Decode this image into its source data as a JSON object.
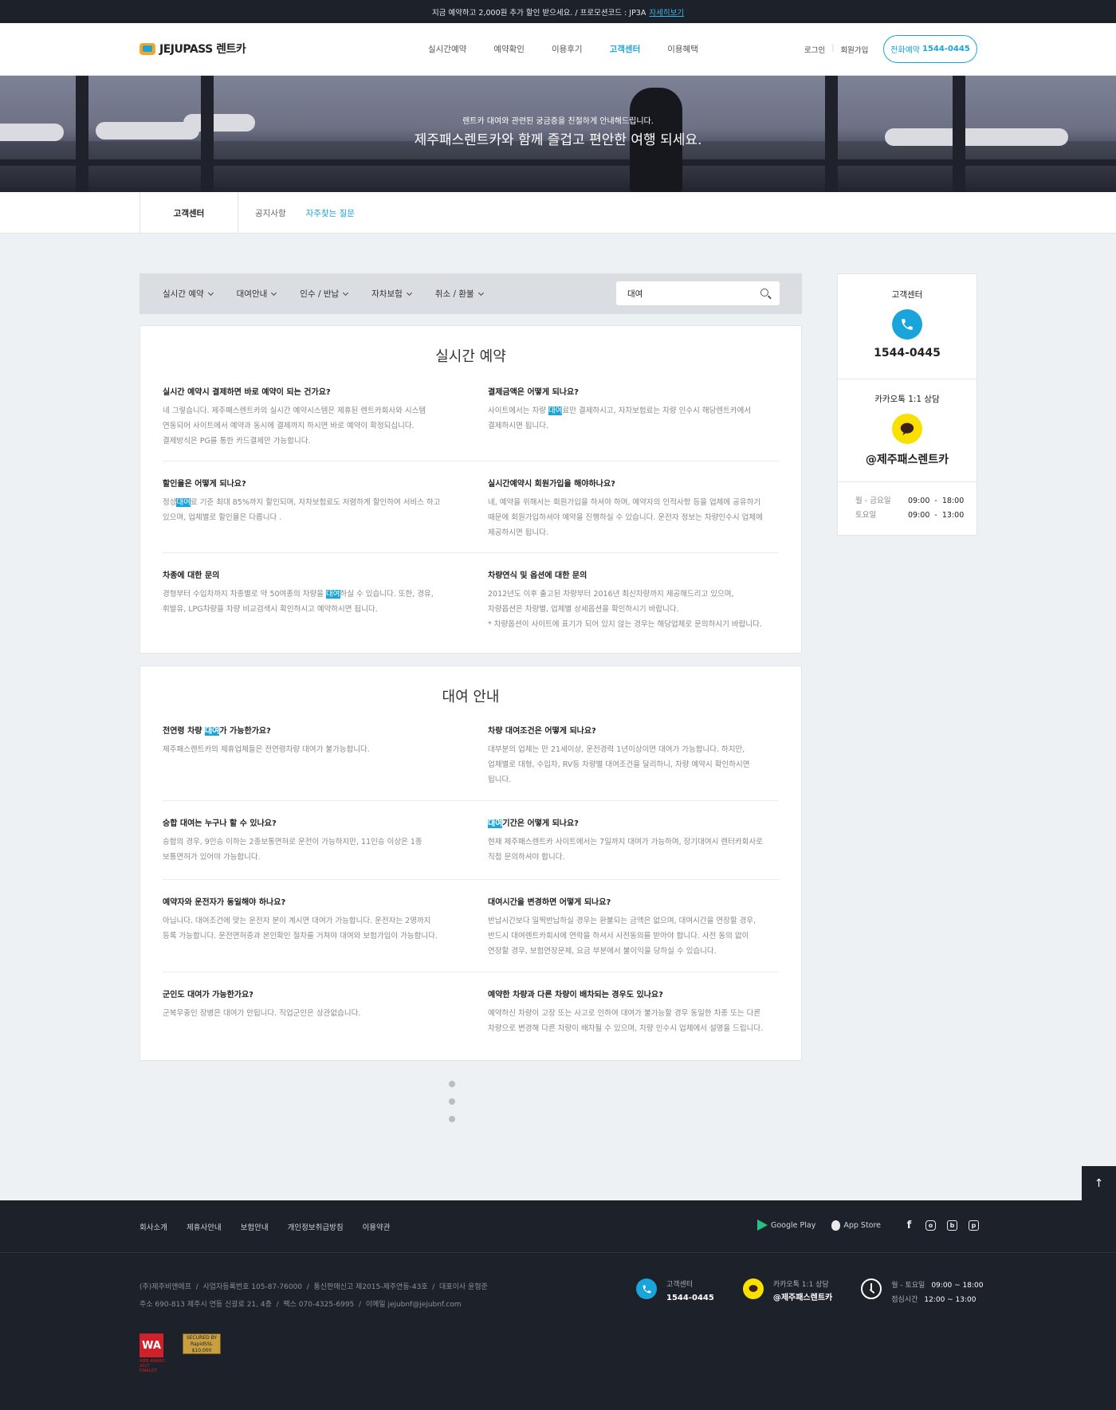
{
  "promo": {
    "text": "지금 예약하고 2,000원 추가 할인 받으세요. / 프로모션코드 : JP3A",
    "link": "자세히보기"
  },
  "header": {
    "logo": "JEJUPASS 렌트카",
    "nav": [
      "실시간예약",
      "예약확인",
      "이용후기",
      "고객센터",
      "이용혜택"
    ],
    "nav_active": "고객센터",
    "login": "로그인",
    "signup": "회원가입",
    "call_label": "전화예약",
    "call_number": "1544-0445"
  },
  "hero": {
    "subtitle": "렌트카 대여와 관련된 궁금증을 친절하게 안내해드립니다.",
    "title": "제주패스렌트카와 함께 즐겁고 편안한 여행 되세요."
  },
  "subnav": {
    "title": "고객센터",
    "items": [
      "공지사항",
      "자주찾는 질문"
    ],
    "active": "자주찾는 질문"
  },
  "filter": {
    "categories": [
      "실시간 예약",
      "대여안내",
      "인수 / 반납",
      "자차보험",
      "취소 / 환불"
    ],
    "search_value": "대여",
    "search_icon": "search-icon"
  },
  "sections": [
    {
      "title": "실시간 예약",
      "items": [
        {
          "q": "실시간 예약시 결제하면 바로 예약이 되는 건가요?",
          "a": [
            "네 그렇습니다. 제주패스렌트카의 실시간 예약시스템은 제휴된 렌트카회사와 시스템",
            "연동되어 사이트에서 예약과 동시에 결제까지 하시면 바로 예약이 확정되십니다.",
            "결제방식은 PG를 통한 카드결제만 가능합니다."
          ]
        },
        {
          "q": "결제금액은 어떻게 되나요?",
          "a": [
            "사이트에서는 차량 [대여]료만 결제하시고, 자차보험료는 차량 인수시 해당렌트카에서",
            "결제하시면 됩니다."
          ]
        },
        {
          "q": "할인율은 어떻게 되나요?",
          "a": [
            "정상[대여]료 기준 최대 85%까지 할인되며, 자차보험료도 저렴하게 할인하여 서비스 하고",
            "있으며, 업체별로 할인율은 다릅니다 ."
          ]
        },
        {
          "q": "실시간예약시 회원가입을 해야하나요?",
          "a": [
            "네, 예약을 위해서는 회원가입을 하셔야 하며, 예약자의 인적사항 등을 업체에 공유하기",
            "때문에 회원가입하셔야 예약을 진행하실 수 있습니다. 운전자 정보는 차량인수시 업체에",
            "제공하시면 됩니다."
          ]
        },
        {
          "q": "차종에 대한 문의",
          "a": [
            "경형부터 수입차까지 차종별로 약 50여종의 차량을 [대여]하실 수 있습니다. 또한, 경유,",
            "휘발유, LPG차량을 차량 비교검색시 확인하시고 예약하시면 됩니다."
          ]
        },
        {
          "q": "차량연식 및 옵션에 대한 문의",
          "a": [
            "2012년도 이후 출고된 차량부터 2016년 최신차량까지 제공해드리고 있으며,",
            "차량옵션은 차량별, 업체별 상세옵션을 확인하시기 바랍니다.",
            "* 차량옵션이 사이트에 표기가 되어 있지 않는 경우는 해당업체로 문의하시기 바랍니다."
          ]
        }
      ]
    },
    {
      "title": "대여 안내",
      "items": [
        {
          "q": "전연령 차량 [대여]가 가능한가요?",
          "a": [
            "제주패스렌트카의 제휴업체들은 전연령차량 대여가 불가능합니다."
          ]
        },
        {
          "q": "차량 대여조건은 어떻게 되나요?",
          "a": [
            "대부분의 업체는 만 21세이상, 운전경력 1년이상이면 대여가 가능합니다. 하지만,",
            "업체별로 대형, 수입차, RV등 차량별 대여조건을 달리하니, 차량 예약시 확인하시면",
            "됩니다."
          ]
        },
        {
          "q": "승합 대여는 누구나 할 수 있나요?",
          "a": [
            "승합의 경우, 9인승 이하는 2종보통면허로 운전이 가능하지만, 11인승 이상은 1종",
            "보통면허가 있어야 가능합니다."
          ]
        },
        {
          "q": "[대여]기간은 어떻게 되나요?",
          "a": [
            "현재 제주패스렌트카 사이트에서는 7일까지 대여가 가능하며, 장기대여시 렌터카회사로",
            "직접 문의하셔야 합니다."
          ]
        },
        {
          "q": "예약자와 운전자가 동일해야 하나요?",
          "a": [
            "아닙니다. 대여조건에 맞는 운전자 분이 계시면 대여가 가능합니다. 운전자는 2명까지",
            "등록 가능합니다. 운전면허증과 본인확인 절차를 거쳐야 대여와 보험가입이 가능합니다."
          ]
        },
        {
          "q": "대여시간을 변경하면 어떻게 되나요?",
          "a": [
            "반납시간보다 일찍반납하실 경우는 환불되는 금액은 없으며, 대여시간을 연장할 경우,",
            "반드시 대여렌트카회사에 연락을 하셔서 사전동의를 받아야 합니다. 사전 동의 없이",
            "연장할 경우, 보험연장문제, 요금 부분에서 불이익을 당하실 수 있습니다."
          ]
        },
        {
          "q": "군인도 대여가 가능한가요?",
          "a": [
            "군복무중인 장병은 대여가 안됩니다. 직업군인은 상관없습니다."
          ]
        },
        {
          "q": "예약한 차량과 다른 차량이 배차되는 경우도 있나요?",
          "a": [
            "예약하신 차량이 고장 또는 사고로 인하여 대여가 불가능할 경우 동일한 차종 또는 다른",
            "차량으로 변경해 다른 차량이 배차될 수 있으며, 차량 인수시 업체에서 설명을 드립니다."
          ]
        }
      ]
    }
  ],
  "sidebar": {
    "center_label": "고객센터",
    "center_number": "1544-0445",
    "kakao_label": "카카오톡 1:1 상담",
    "kakao_id": "@제주패스렌트카",
    "hours": [
      {
        "day": "월 - 금요일",
        "time": "09:00  -  18:00"
      },
      {
        "day": "토요일",
        "time": "09:00  -  13:00"
      }
    ]
  },
  "totop": "↑",
  "footer": {
    "links": [
      "회사소개",
      "제휴사안내",
      "보험안내",
      "개인정보취급방침",
      "이용약관"
    ],
    "apps": [
      "Google Play",
      "App Store"
    ],
    "info": [
      "(주)제주비앤에프  /  사업자등록번호 105-87-76000  /  통신판매신고 제2015-제주연동-43호  /  대표이사 윤형준",
      "주소 690-813 제주시 연동 신광로 21, 4층  /  팩스 070-4325-6995  /  이메일 jejubnf@jejubnf.com"
    ],
    "center_label": "고객센터",
    "center_number": "1544-0445",
    "kakao_label": "카카오톡 1:1 상담",
    "kakao_id": "@제주패스렌트카",
    "hours": [
      {
        "day": "월 - 토요일",
        "time": "09:00 ~ 18:00"
      },
      {
        "day": "점심시간",
        "time": "12:00 ~ 13:00"
      }
    ],
    "badge_wa": "WA",
    "badge_wa_sub": "WEB AWARD 2017 FINALIST",
    "badge_ssl": "SECURED BY RapidSSL $10,000 Warranty"
  },
  "colors": {
    "accent": "#1aa4dc",
    "dark": "#1d2129",
    "kakao": "#f9e000",
    "highlight": "#1aa4dc"
  }
}
